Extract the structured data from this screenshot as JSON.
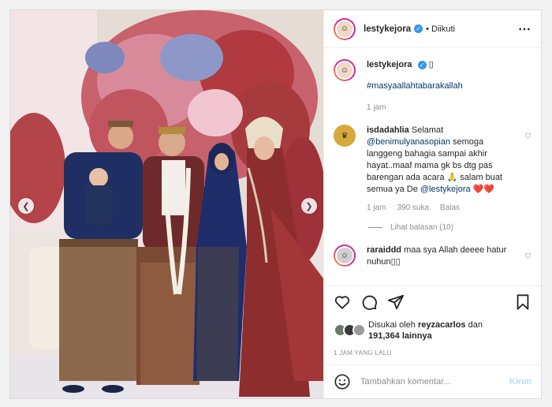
{
  "post": {
    "username": "lestykejora",
    "follow_state": "• Diikuti",
    "more_icon": "⋯"
  },
  "caption": {
    "username": "lestykejora",
    "emoji_box": "▯",
    "hashtag": "#masyaallahtabarakallah",
    "time": "1 jam"
  },
  "comments": [
    {
      "username": "isdadahlia",
      "text_1": "Selamat",
      "mention_1": "@benimulyanasopian",
      "text_2": "semoga langgeng bahagia sampai akhir hayat..maaf mama gk bs dtg pas barengan ada acara 🙏 salam buat semua ya De",
      "mention_2": "@lestykejora",
      "hearts": "❤️❤️",
      "time": "1 jam",
      "likes": "390 suka",
      "reply": "Balas",
      "view_replies": "Lihat balasan (10)"
    },
    {
      "username": "raraiddd",
      "text": "maa sya Allah deeee hatur nuhun▯▯"
    }
  ],
  "likes_summary": {
    "prefix": "Disukai oleh",
    "user": "reyzacarlos",
    "connector": "dan",
    "count": "191,364",
    "suffix": "lainnya"
  },
  "timestamp": "1 JAM YANG LALU",
  "comment_input": {
    "placeholder": "Tambahkan komentar...",
    "post_label": "Kirim"
  },
  "colors": {
    "link": "#00376b",
    "verified": "#3897f0",
    "post_disabled": "#b2dffc"
  },
  "icons": [
    "chevron-left-icon",
    "chevron-right-icon",
    "heart-icon",
    "comment-icon",
    "share-icon",
    "bookmark-icon",
    "emoji-icon",
    "verified-icon"
  ]
}
